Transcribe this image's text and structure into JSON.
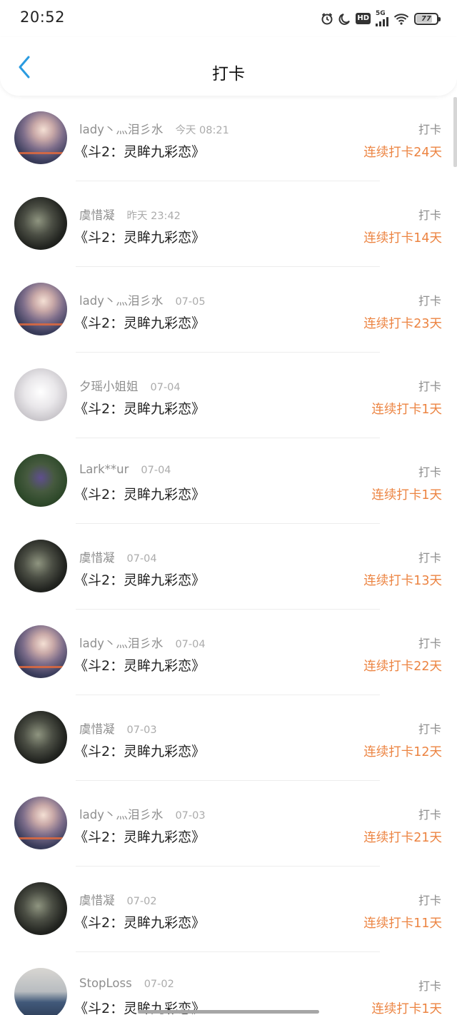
{
  "status_bar": {
    "time": "20:52",
    "hd": "HD",
    "network": "5G",
    "battery": "77",
    "battery_level": 0.77
  },
  "header": {
    "title": "打卡",
    "back_icon": "chevron-left-icon"
  },
  "colors": {
    "accent_orange": "#ec8442",
    "back_blue": "#2a9be0"
  },
  "records": [
    {
      "user": "lady丶灬泪彡水",
      "time": "今天 08:21",
      "book": "《斗2：灵眸九彩恋》",
      "tag": "打卡",
      "streak": "连续打卡24天",
      "avatar": "lady"
    },
    {
      "user": "虞惜凝",
      "time": "昨天 23:42",
      "book": "《斗2：灵眸九彩恋》",
      "tag": "打卡",
      "streak": "连续打卡14天",
      "avatar": "yu"
    },
    {
      "user": "lady丶灬泪彡水",
      "time": "07-05",
      "book": "《斗2：灵眸九彩恋》",
      "tag": "打卡",
      "streak": "连续打卡23天",
      "avatar": "lady"
    },
    {
      "user": "夕瑶小姐姐",
      "time": "07-04",
      "book": "《斗2：灵眸九彩恋》",
      "tag": "打卡",
      "streak": "连续打卡1天",
      "avatar": "xi"
    },
    {
      "user": "Lark**ur",
      "time": "07-04",
      "book": "《斗2：灵眸九彩恋》",
      "tag": "打卡",
      "streak": "连续打卡1天",
      "avatar": "lark"
    },
    {
      "user": "虞惜凝",
      "time": "07-04",
      "book": "《斗2：灵眸九彩恋》",
      "tag": "打卡",
      "streak": "连续打卡13天",
      "avatar": "yu"
    },
    {
      "user": "lady丶灬泪彡水",
      "time": "07-04",
      "book": "《斗2：灵眸九彩恋》",
      "tag": "打卡",
      "streak": "连续打卡22天",
      "avatar": "lady"
    },
    {
      "user": "虞惜凝",
      "time": "07-03",
      "book": "《斗2：灵眸九彩恋》",
      "tag": "打卡",
      "streak": "连续打卡12天",
      "avatar": "yu"
    },
    {
      "user": "lady丶灬泪彡水",
      "time": "07-03",
      "book": "《斗2：灵眸九彩恋》",
      "tag": "打卡",
      "streak": "连续打卡21天",
      "avatar": "lady"
    },
    {
      "user": "虞惜凝",
      "time": "07-02",
      "book": "《斗2：灵眸九彩恋》",
      "tag": "打卡",
      "streak": "连续打卡11天",
      "avatar": "yu"
    },
    {
      "user": "StopLoss",
      "time": "07-02",
      "book": "《斗2：灵眸九彩恋》",
      "tag": "打卡",
      "streak": "连续打卡1天",
      "avatar": "stop"
    }
  ]
}
